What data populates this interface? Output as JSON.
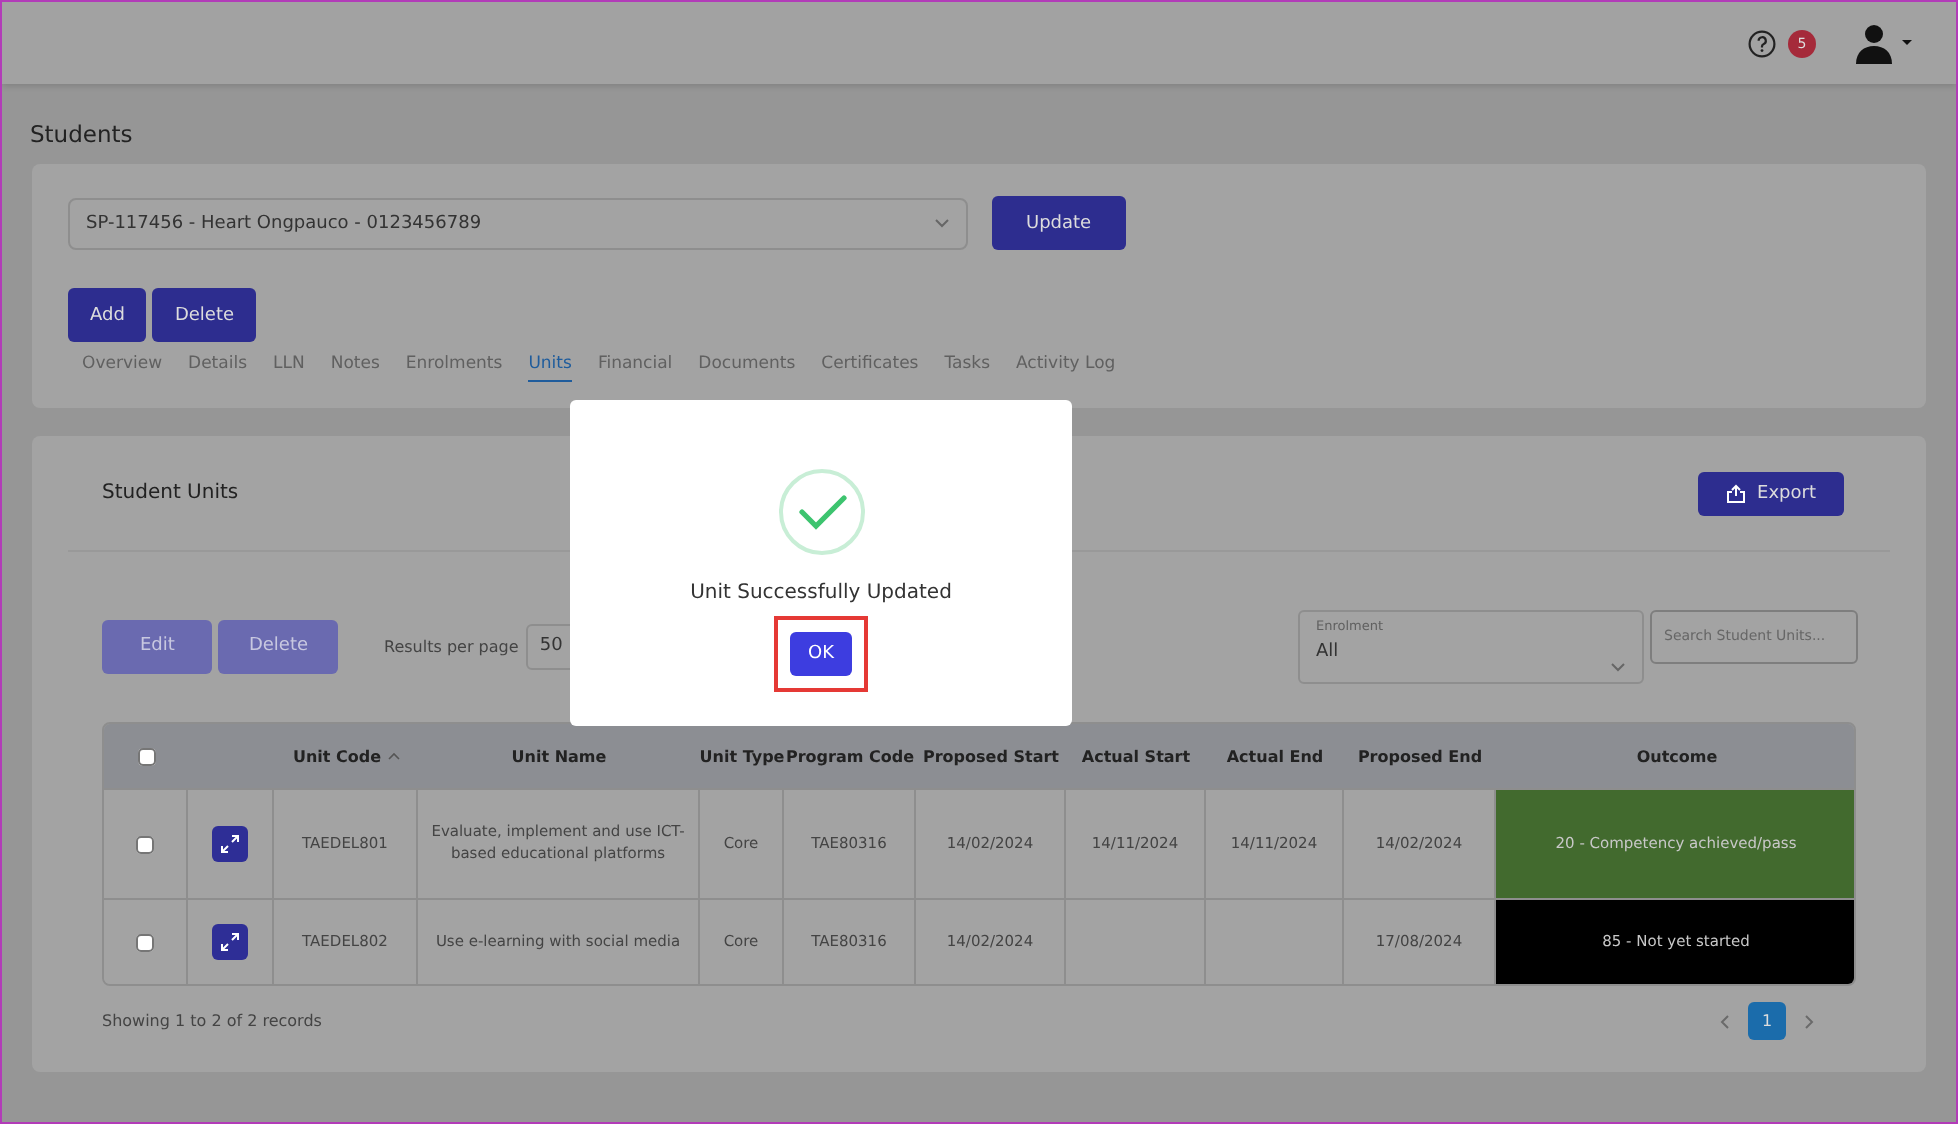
{
  "topbar": {
    "notification_count": "5"
  },
  "page_title": "Students",
  "student_select": {
    "value": "SP-117456 - Heart Ongpauco - 0123456789"
  },
  "update_button": "Update",
  "record_buttons": [
    "Add",
    "Delete"
  ],
  "tabs": [
    {
      "label": "Overview",
      "selected": false
    },
    {
      "label": "Details",
      "selected": false
    },
    {
      "label": "LLN",
      "selected": false
    },
    {
      "label": "Notes",
      "selected": false
    },
    {
      "label": "Enrolments",
      "selected": false
    },
    {
      "label": "Units",
      "selected": true
    },
    {
      "label": "Financial",
      "selected": false
    },
    {
      "label": "Documents",
      "selected": false
    },
    {
      "label": "Certificates",
      "selected": false
    },
    {
      "label": "Tasks",
      "selected": false
    },
    {
      "label": "Activity Log",
      "selected": false
    }
  ],
  "units_panel": {
    "title": "Student Units",
    "export_button": "Export",
    "action_buttons": [
      "Edit",
      "Delete"
    ],
    "results_per_page": {
      "label": "Results per page",
      "value": "50"
    },
    "enrolment_filter": {
      "label": "Enrolment",
      "value": "All"
    },
    "search": {
      "placeholder": "Search Student Units..."
    },
    "table": {
      "select_all_checked": false,
      "columns": [
        {
          "label": "Unit Code",
          "sorted": true
        },
        {
          "label": "Unit Name",
          "sorted": false
        },
        {
          "label": "Unit Type",
          "sorted": false
        },
        {
          "label": "Program Code",
          "sorted": false
        },
        {
          "label": "Proposed Start",
          "sorted": false
        },
        {
          "label": "Actual Start",
          "sorted": false
        },
        {
          "label": "Actual End",
          "sorted": false
        },
        {
          "label": "Proposed End",
          "sorted": false
        },
        {
          "label": "Outcome",
          "sorted": false
        }
      ],
      "rows": [
        {
          "checked": false,
          "unit_code": "TAEDEL801",
          "unit_name": "Evaluate, implement and use ICT-based educational platforms",
          "unit_type": "Core",
          "program_code": "TAE80316",
          "proposed_start": "14/02/2024",
          "actual_start": "14/11/2024",
          "actual_end": "14/11/2024",
          "proposed_end": "14/02/2024",
          "outcome": "20 - Competency achieved/pass",
          "color": "#426a2e"
        },
        {
          "checked": false,
          "unit_code": "TAEDEL802",
          "unit_name": "Use e-learning with social media",
          "unit_type": "Core",
          "program_code": "TAE80316",
          "proposed_start": "14/02/2024",
          "proposed_end": "17/08/2024",
          "outcome": "85 - Not yet started",
          "color": "#000000"
        }
      ]
    },
    "footer": "Showing 1 to 2 of 2 records",
    "pages": [
      {
        "label": "1",
        "selected": true
      }
    ]
  },
  "dialog": {
    "message": "Unit Successfully Updated",
    "ok_button": "OK",
    "highlighted": true
  }
}
